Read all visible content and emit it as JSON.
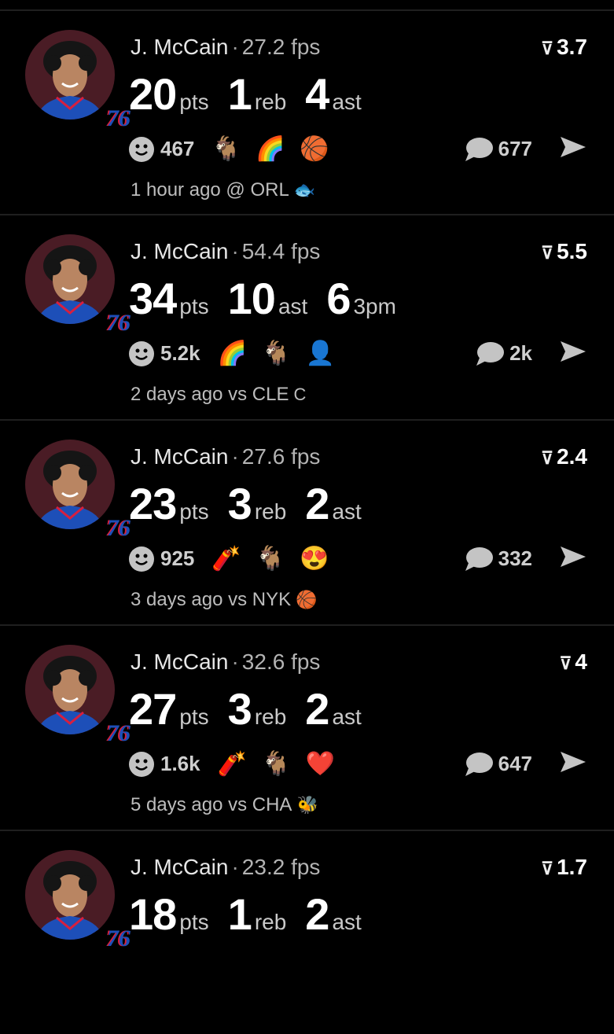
{
  "feed": {
    "items": [
      {
        "player": "J. McCain",
        "fps": "27.2 fps",
        "score": "3.7",
        "stats": [
          {
            "n": "20",
            "u": "pts"
          },
          {
            "n": "1",
            "u": "reb"
          },
          {
            "n": "4",
            "u": "ast"
          }
        ],
        "reactions_count": "467",
        "emojis": [
          "🐐",
          "🌈",
          "🏀"
        ],
        "emoji_names": [
          "goat-emoji",
          "rainbow-emoji",
          "player-emoji"
        ],
        "comments": "677",
        "time": "1 hour ago @ ORL",
        "team_mark": "🐟",
        "team_mark_name": "magic-logo-icon"
      },
      {
        "player": "J. McCain",
        "fps": "54.4 fps",
        "score": "5.5",
        "stats": [
          {
            "n": "34",
            "u": "pts"
          },
          {
            "n": "10",
            "u": "ast"
          },
          {
            "n": "6",
            "u": "3pm"
          }
        ],
        "reactions_count": "5.2k",
        "emojis": [
          "🌈",
          "🐐",
          "👤"
        ],
        "emoji_names": [
          "rainbow-emoji",
          "goat-emoji",
          "player-emoji"
        ],
        "comments": "2k",
        "time": "2 days ago vs CLE",
        "team_mark": "C",
        "team_mark_name": "cavaliers-logo-icon"
      },
      {
        "player": "J. McCain",
        "fps": "27.6 fps",
        "score": "2.4",
        "stats": [
          {
            "n": "23",
            "u": "pts"
          },
          {
            "n": "3",
            "u": "reb"
          },
          {
            "n": "2",
            "u": "ast"
          }
        ],
        "reactions_count": "925",
        "emojis": [
          "🧨",
          "🐐",
          "😍"
        ],
        "emoji_names": [
          "fuse-emoji",
          "goat-emoji",
          "heart-eyes-emoji"
        ],
        "comments": "332",
        "time": "3 days ago vs NYK",
        "team_mark": "🏀",
        "team_mark_name": "knicks-logo-icon"
      },
      {
        "player": "J. McCain",
        "fps": "32.6 fps",
        "score": "4",
        "stats": [
          {
            "n": "27",
            "u": "pts"
          },
          {
            "n": "3",
            "u": "reb"
          },
          {
            "n": "2",
            "u": "ast"
          }
        ],
        "reactions_count": "1.6k",
        "emojis": [
          "🧨",
          "🐐",
          "❤️"
        ],
        "emoji_names": [
          "fuse-emoji",
          "goat-emoji",
          "heart-emoji"
        ],
        "comments": "647",
        "time": "5 days ago vs CHA",
        "team_mark": "🐝",
        "team_mark_name": "hornets-logo-icon"
      },
      {
        "player": "J. McCain",
        "fps": "23.2 fps",
        "score": "1.7",
        "stats": [
          {
            "n": "18",
            "u": "pts"
          },
          {
            "n": "1",
            "u": "reb"
          },
          {
            "n": "2",
            "u": "ast"
          }
        ],
        "reactions_count": "",
        "emojis": [],
        "emoji_names": [],
        "comments": "",
        "time": "",
        "team_mark": "",
        "team_mark_name": ""
      }
    ],
    "team_badge": "76",
    "colors": {
      "background": "#000000",
      "avatar_bg": "#4a1c25",
      "jersey_blue": "#1d4fb8",
      "jersey_red": "#d71f3f"
    }
  }
}
